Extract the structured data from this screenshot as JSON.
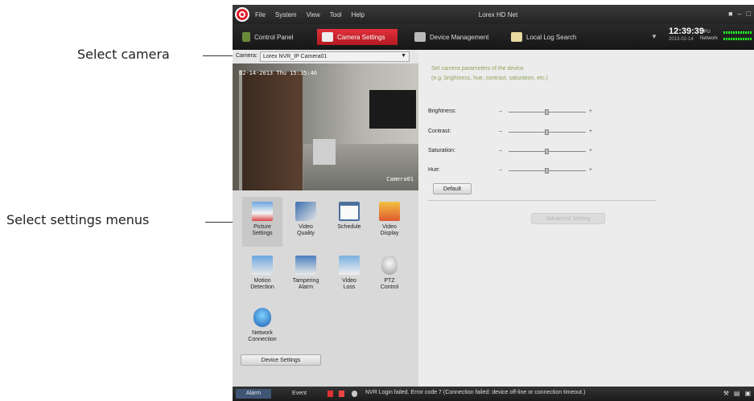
{
  "callouts": {
    "select_camera": "Select camera",
    "select_settings": "Select settings menus"
  },
  "window": {
    "title": "Lorex HD Net",
    "menu": [
      "File",
      "System",
      "View",
      "Tool",
      "Help"
    ]
  },
  "tabs": [
    {
      "label": "Control Panel",
      "active": false
    },
    {
      "label": "Camera Settings",
      "active": true
    },
    {
      "label": "Device Management",
      "active": false
    },
    {
      "label": "Local Log Search",
      "active": false
    }
  ],
  "status": {
    "time": "12:39:39",
    "date": "2013-02-14",
    "cpu_label": "CPU",
    "network_label": "Network"
  },
  "camera": {
    "label": "Camera:",
    "selected": "Lorex NVR_IP Camera01"
  },
  "video": {
    "timestamp": "02-14-2013 Thu 15:35:46",
    "camera_name": "Camera01"
  },
  "settings_menu": [
    {
      "label_1": "Picture",
      "label_2": "Settings",
      "icon": "picture-icon",
      "selected": true
    },
    {
      "label_1": "Video",
      "label_2": "Quality",
      "icon": "video-quality-icon",
      "selected": false
    },
    {
      "label_1": "Schedule",
      "label_2": "",
      "icon": "schedule-icon",
      "selected": false
    },
    {
      "label_1": "Video",
      "label_2": "Display",
      "icon": "video-display-icon",
      "selected": false
    },
    {
      "label_1": "Motion",
      "label_2": "Detection",
      "icon": "motion-icon",
      "selected": false
    },
    {
      "label_1": "Tampering",
      "label_2": "Alarm",
      "icon": "tampering-icon",
      "selected": false
    },
    {
      "label_1": "Video",
      "label_2": "Loss",
      "icon": "video-loss-icon",
      "selected": false
    },
    {
      "label_1": "PTZ",
      "label_2": "Control",
      "icon": "ptz-icon",
      "selected": false
    },
    {
      "label_1": "Network",
      "label_2": "Connection",
      "icon": "network-icon",
      "selected": false
    }
  ],
  "device_settings_label": "Device Settings",
  "picture": {
    "description_1": "Set camera parameters of the device",
    "description_2": "(e.g. brightness, hue, contrast, saturation, etc.)",
    "sliders": [
      {
        "label": "Brightness:",
        "value": 0.5
      },
      {
        "label": "Contrast:",
        "value": 0.5
      },
      {
        "label": "Saturation:",
        "value": 0.5
      },
      {
        "label": "Hue:",
        "value": 0.5
      }
    ],
    "default_label": "Default",
    "advanced_label": "Advanced Setting"
  },
  "statusbar": {
    "alarm_tab": "Alarm",
    "event_tab": "Event",
    "message": "NVR Login failed. Error code 7 (Connection failed: device off-line or connection timeout.)"
  },
  "colors": {
    "accent_red": "#d42a33",
    "hint_green": "#8fa55a",
    "titlebar": "#2b2b2b"
  }
}
